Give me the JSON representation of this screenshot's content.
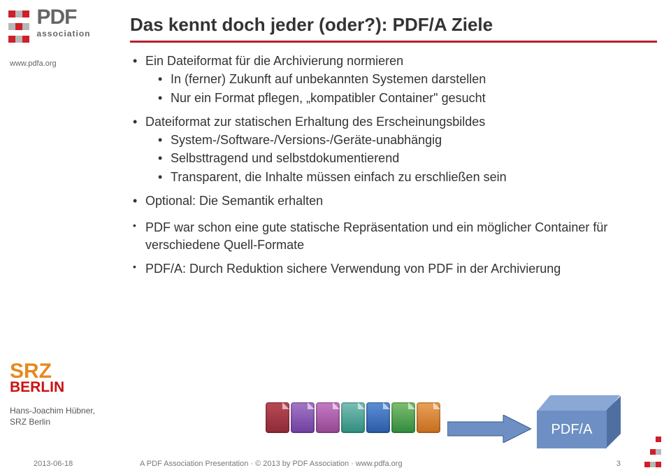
{
  "brand": {
    "name": "PDF",
    "sub": "association",
    "url": "www.pdfa.org"
  },
  "srz": {
    "line1": "SRZ",
    "line2": "BERLIN"
  },
  "author": {
    "name": "Hans-Joachim Hübner,",
    "org": "SRZ Berlin"
  },
  "title": "Das kennt doch jeder (oder?): PDF/A Ziele",
  "bullets": {
    "b1": "Ein Dateiformat für die Archivierung normieren",
    "b1_1": "In (ferner) Zukunft auf unbekannten Systemen darstellen",
    "b1_2": "Nur ein Format pflegen, „kompatibler Container\" gesucht",
    "b2": "Dateiformat zur statischen Erhaltung des Erscheinungsbildes",
    "b2_1": "System-/Software-/Versions-/Geräte-unabhängig",
    "b2_2": "Selbsttragend und selbstdokumentierend",
    "b2_3": "Transparent, die Inhalte müssen einfach zu erschließen sein",
    "b3": "Optional: Die Semantik erhalten",
    "a1": "PDF war schon eine gute statische Repräsentation und ein möglicher Container für verschiedene Quell-Formate",
    "a2": "PDF/A: Durch Reduktion sichere Verwendung von PDF in der Archivierung"
  },
  "cube_label": "PDF/A",
  "footer": {
    "date": "2013-06-18",
    "credit": "A PDF Association Presentation · © 2013 by PDF Association · www.pdfa.org",
    "page": "3"
  }
}
